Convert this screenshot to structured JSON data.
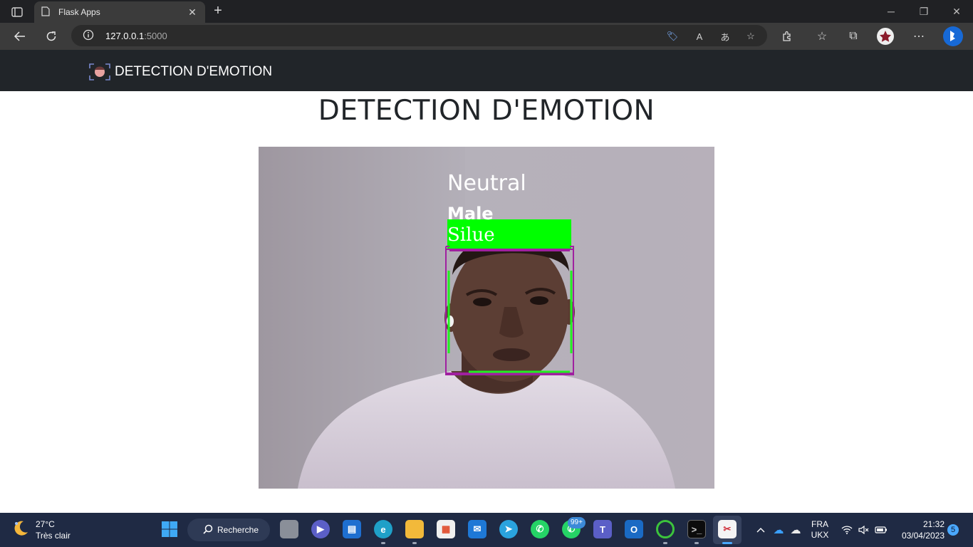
{
  "browser": {
    "tab_title": "Flask Apps",
    "url_host": "127.0.0.1",
    "url_port": ":5000"
  },
  "site": {
    "brand": "DETECTION D'EMOTION",
    "heading": "DETECTION D'EMOTION"
  },
  "video": {
    "emotion_label": "Neutral",
    "gender_label": "Male",
    "name_label": "Silue",
    "box_color": "#00ff00",
    "frame_color": "#a020a0"
  },
  "taskbar": {
    "weather_temp": "27°C",
    "weather_desc": "Très clair",
    "search_label": "Recherche",
    "whatsapp_badge": "99+",
    "lang_top": "FRA",
    "lang_bottom": "UKX",
    "time": "21:32",
    "date": "03/04/2023",
    "notifications": "5"
  },
  "colors": {
    "chrome_dark": "#202124",
    "navbar": "#212529",
    "taskbar": "#1f2a44"
  }
}
